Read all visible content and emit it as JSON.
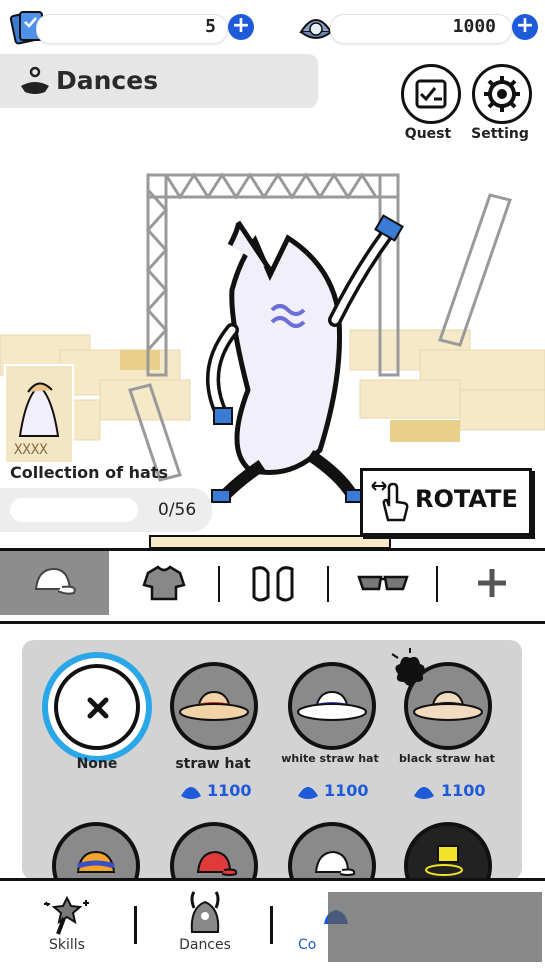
{
  "currency": {
    "tickets": {
      "value": "5",
      "icon": "ticket-icon"
    },
    "pearls": {
      "value": "1000",
      "icon": "shell-pearl-icon"
    }
  },
  "header": {
    "title": "Dances",
    "title_icon": "dance-icon"
  },
  "top_buttons": [
    {
      "label": "Quest",
      "icon": "checklist-icon"
    },
    {
      "label": "Setting",
      "icon": "gear-icon"
    }
  ],
  "collection": {
    "title": "Collection of hats",
    "progress": "0/56",
    "progress_fraction": 0.0
  },
  "rotate": {
    "label": "ROTATE"
  },
  "categories": [
    {
      "name": "hats",
      "icon": "cap-icon",
      "active": true
    },
    {
      "name": "tops",
      "icon": "sweater-icon",
      "active": false
    },
    {
      "name": "shoes",
      "icon": "sneakers-icon",
      "active": false
    },
    {
      "name": "glasses",
      "icon": "sunglasses-icon",
      "active": false
    },
    {
      "name": "more",
      "icon": "plus-icon",
      "active": false
    }
  ],
  "items": [
    {
      "name": "None",
      "price": "",
      "selected": true
    },
    {
      "name": "straw hat",
      "price": "1100"
    },
    {
      "name": "white straw hat",
      "price": "1100"
    },
    {
      "name": "black straw hat",
      "price": "1100"
    }
  ],
  "bottom_nav": [
    {
      "label": "Skills",
      "icon": "magic-wand-icon"
    },
    {
      "label": "Dances",
      "icon": "dance-icon"
    },
    {
      "label": "Co",
      "icon": "closet-icon",
      "active": true
    }
  ],
  "colors": {
    "accent": "#1f5bd8",
    "selected_ring": "#2aa7e8",
    "panel": "#d3d3d3"
  }
}
